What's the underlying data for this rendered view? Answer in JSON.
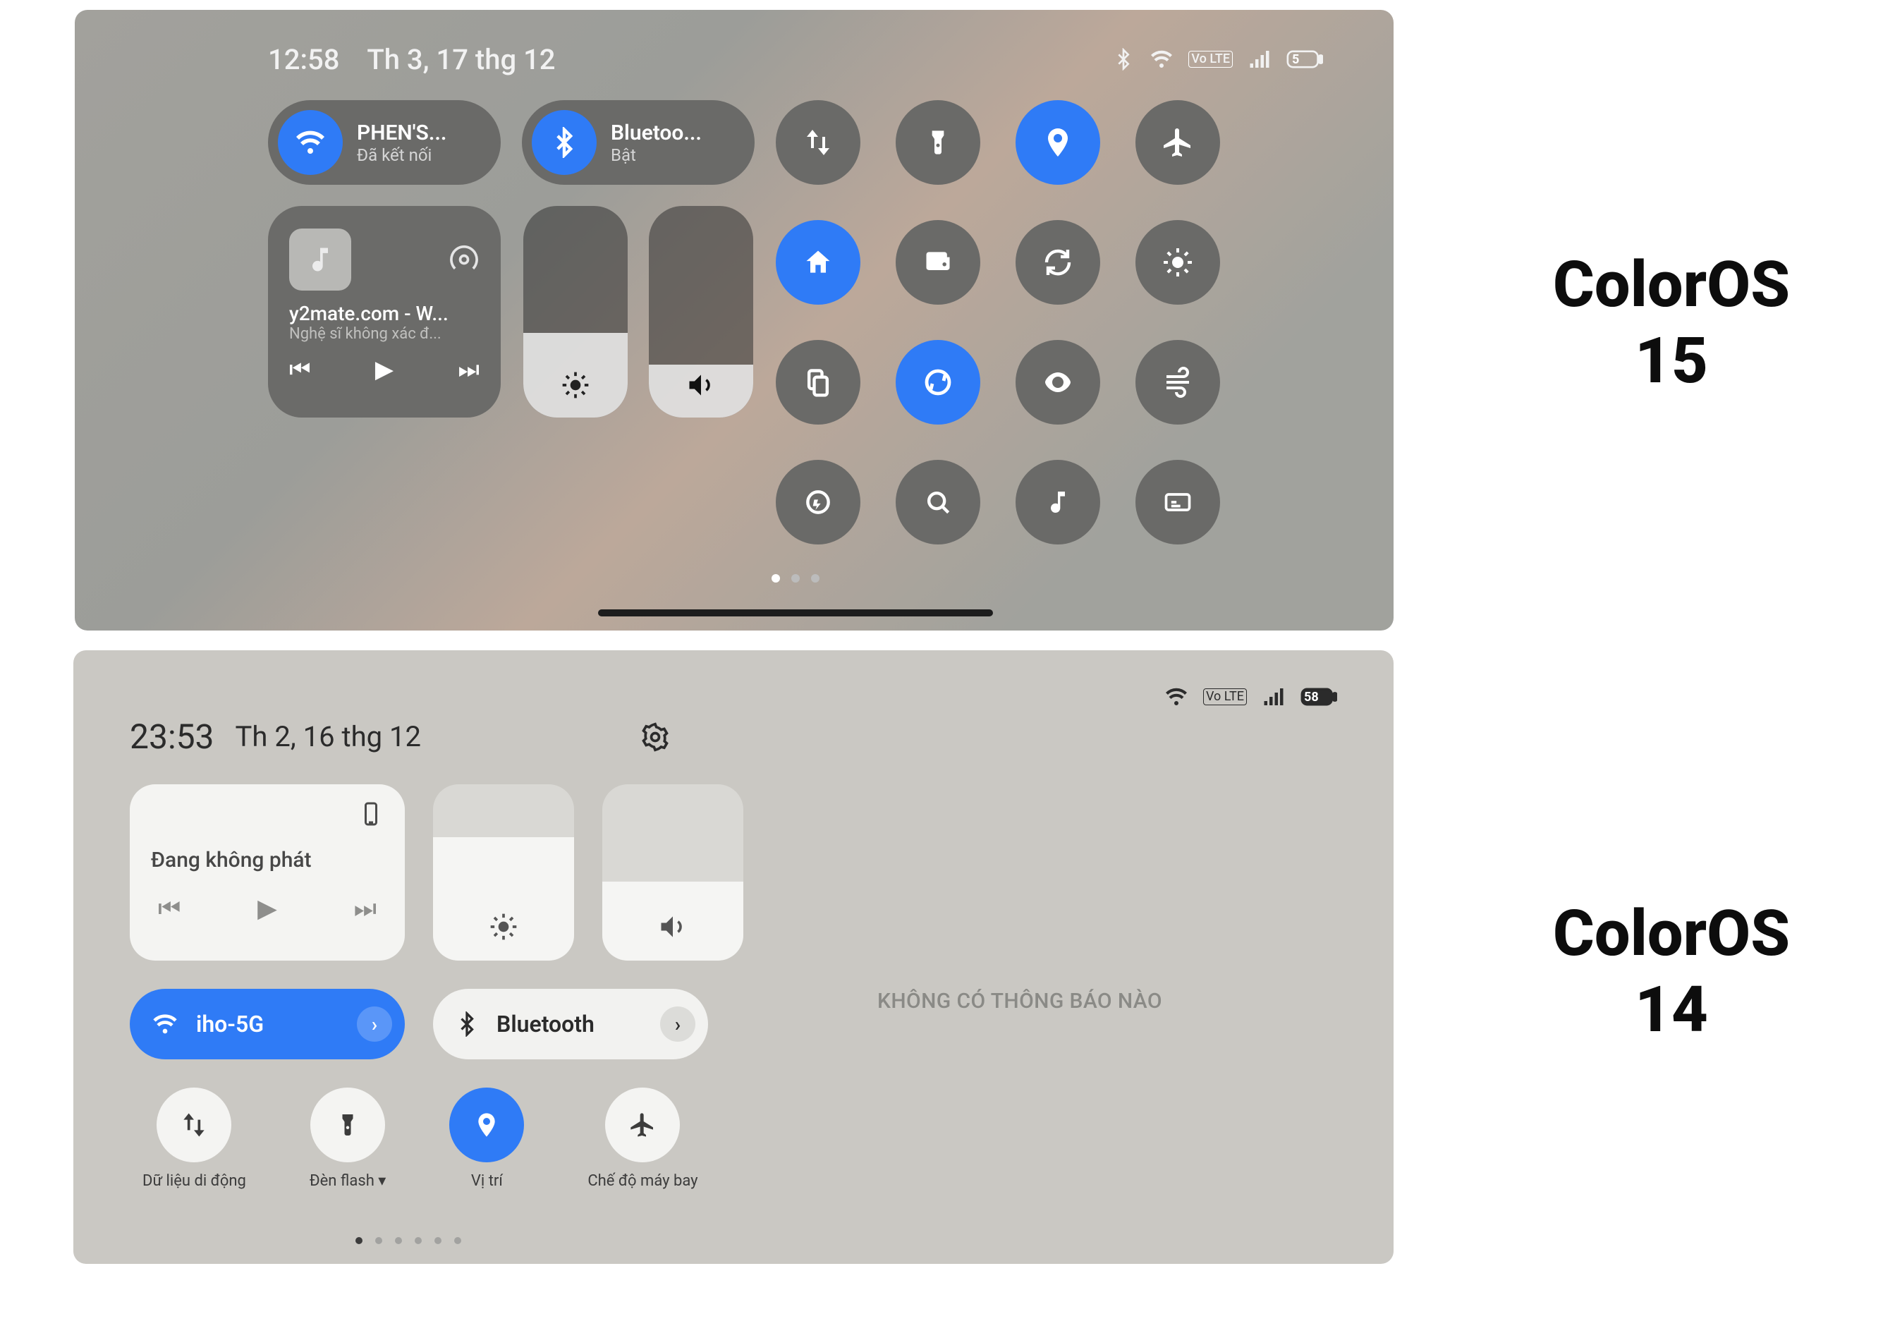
{
  "label_top": "ColorOS 15",
  "label_bottom": "ColorOS 14",
  "coloros15": {
    "status": {
      "time": "12:58",
      "date": "Th 3, 17 thg 12",
      "battery": "5",
      "volte": "Vo LTE"
    },
    "wifi": {
      "name": "PHEN'S...",
      "sub": "Đã kết nối"
    },
    "bluetooth": {
      "name": "Bluetoo...",
      "sub": "Bật"
    },
    "media": {
      "title": "y2mate.com - W...",
      "subtitle": "Nghệ sĩ không xác đ..."
    },
    "brightness_pct": 40,
    "volume_pct": 25,
    "toggles": [
      {
        "name": "mobile-data",
        "on": false
      },
      {
        "name": "flashlight",
        "on": false
      },
      {
        "name": "location",
        "on": true
      },
      {
        "name": "airplane",
        "on": false
      },
      {
        "name": "home",
        "on": true
      },
      {
        "name": "wallet",
        "on": false
      },
      {
        "name": "rotation",
        "on": false
      },
      {
        "name": "brightness-auto",
        "on": false
      },
      {
        "name": "split-screen",
        "on": false
      },
      {
        "name": "sync",
        "on": true
      },
      {
        "name": "eye-comfort",
        "on": false
      },
      {
        "name": "wind",
        "on": false
      },
      {
        "name": "dnd",
        "on": false
      },
      {
        "name": "search",
        "on": false
      },
      {
        "name": "music",
        "on": false
      },
      {
        "name": "captions",
        "on": false
      }
    ],
    "page": 1,
    "pages": 3
  },
  "coloros14": {
    "status": {
      "time": "23:53",
      "date": "Th 2, 16 thg 12",
      "battery": "58",
      "volte": "Vo LTE"
    },
    "media": {
      "title": "Đang không phát"
    },
    "brightness_pct": 70,
    "volume_pct": 45,
    "wifi": {
      "name": "iho-5G",
      "on": true
    },
    "bluetooth": {
      "name": "Bluetooth",
      "on": false
    },
    "quick": [
      {
        "name": "mobile-data",
        "label": "Dữ liệu di động",
        "on": false
      },
      {
        "name": "flashlight",
        "label": "Đèn flash ▾",
        "on": false
      },
      {
        "name": "location",
        "label": "Vị trí",
        "on": true
      },
      {
        "name": "airplane",
        "label": "Chế độ máy bay",
        "on": false
      }
    ],
    "notif_empty": "KHÔNG CÓ THÔNG BÁO NÀO",
    "page": 1,
    "pages": 6
  }
}
